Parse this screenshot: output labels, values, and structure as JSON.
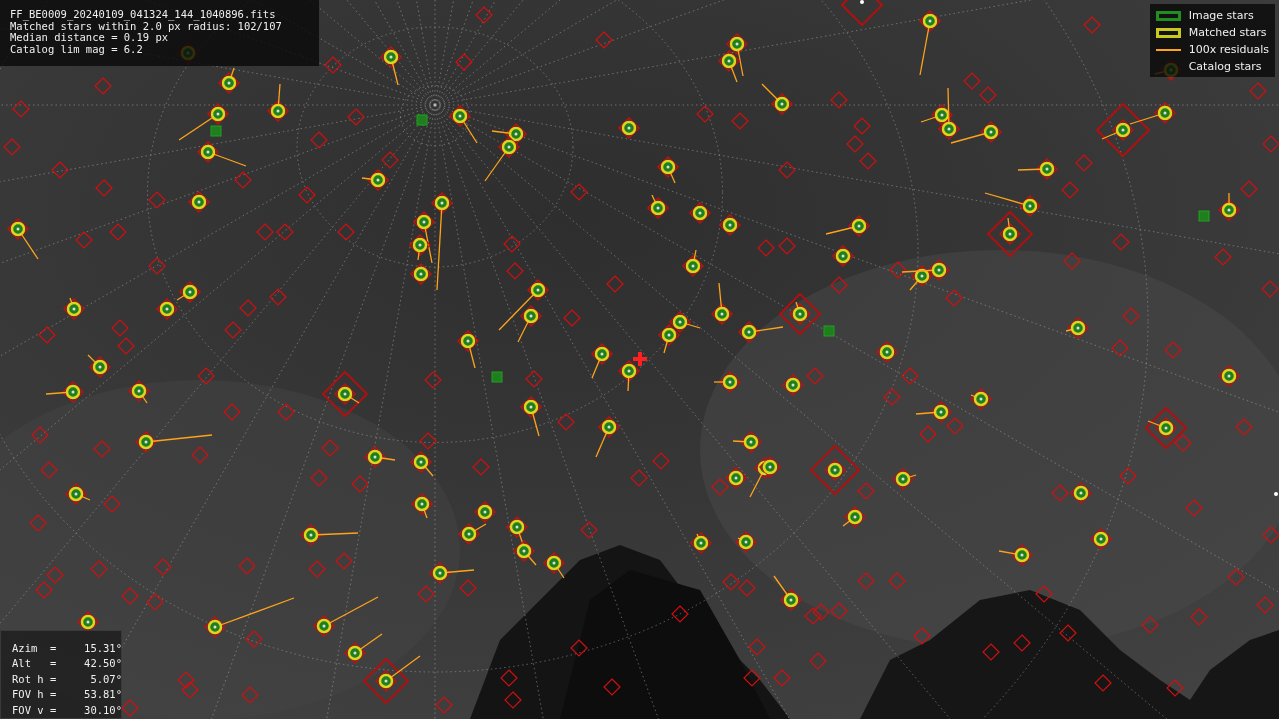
{
  "info_panel": {
    "lines": [
      "FF_BE0009_20240109_041324_144_1040896.fits",
      "Matched stars within 2.0 px radius: 102/107",
      "Median distance = 0.19 px",
      "Catalog lim mag = 6.2"
    ]
  },
  "legend": {
    "items": [
      {
        "label": "Image stars",
        "kind": "box",
        "color": "#1f8f1f"
      },
      {
        "label": "Matched stars",
        "kind": "box",
        "color": "#c8c81e"
      },
      {
        "label": "100x residuals",
        "kind": "line",
        "color": "#ffa31a"
      },
      {
        "label": "Catalog stars",
        "kind": "none"
      }
    ]
  },
  "pointing_panel": {
    "rows": [
      {
        "label": "Azim  =",
        "value": "15.31°"
      },
      {
        "label": "Alt   =",
        "value": "42.50°"
      },
      {
        "label": "Rot h =",
        "value": "5.07°"
      },
      {
        "label": "FOV h =",
        "value": "53.81°"
      },
      {
        "label": "FOV v =",
        "value": "30.10°"
      }
    ]
  }
}
